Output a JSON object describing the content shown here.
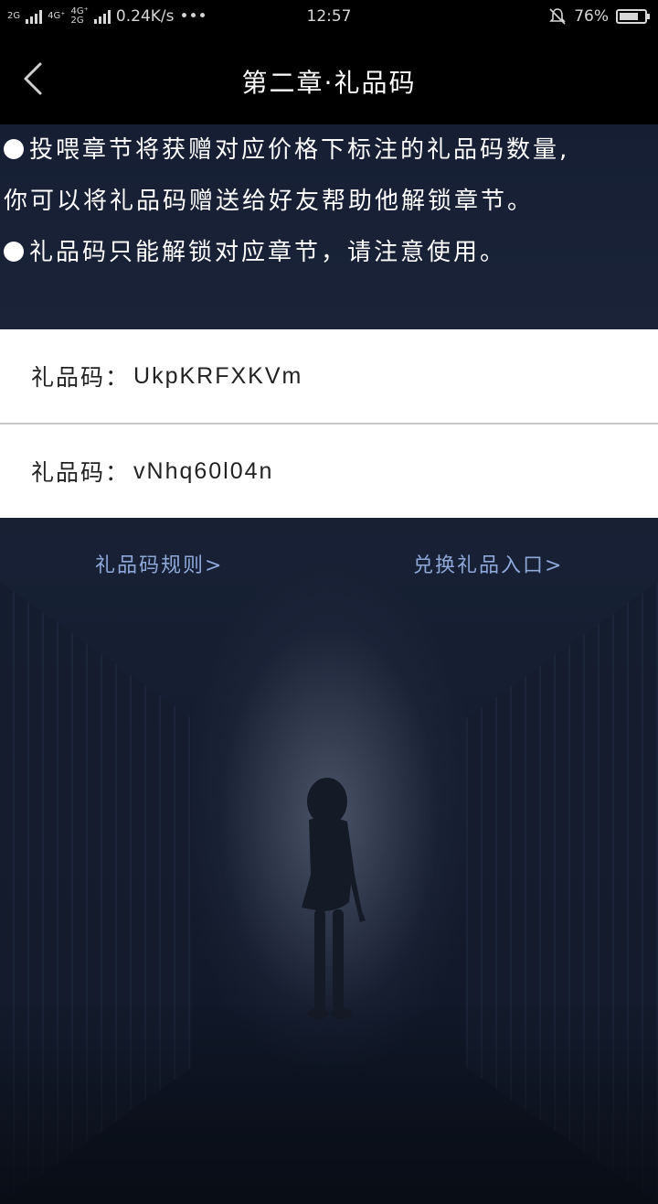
{
  "status_bar": {
    "network_1": "2G",
    "network_2": "4G⁺",
    "network_3": "4G⁺",
    "network_4": "2G",
    "speed": "0.24K/s",
    "dots": "•••",
    "time": "12:57",
    "battery_percent": "76%",
    "battery_level": 0.76
  },
  "header": {
    "title": "第二章·礼品码"
  },
  "info": {
    "line1": "投喂章节将获赠对应价格下标注的礼品码数量,",
    "line2": "你可以将礼品码赠送给好友帮助他解锁章节。",
    "line3": "礼品码只能解锁对应章节，请注意使用。"
  },
  "codes": [
    {
      "label": "礼品码：",
      "value": "UkpKRFXKVm"
    },
    {
      "label": "礼品码：",
      "value": "vNhq60l04n"
    }
  ],
  "links": {
    "rules": "礼品码规则>",
    "redeem": "兑换礼品入口>"
  },
  "colors": {
    "header_bg": "#000000",
    "link": "#8fa8d8",
    "panel_bg": "#ffffff"
  }
}
